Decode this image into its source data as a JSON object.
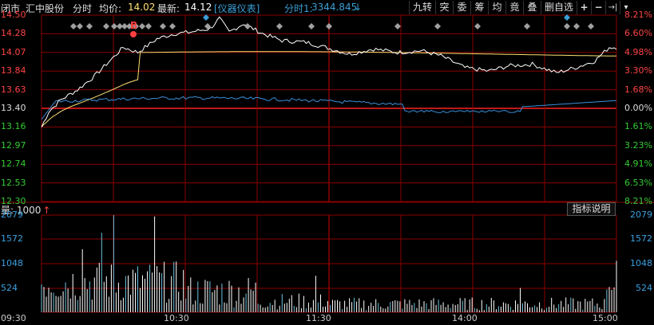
{
  "header": {
    "market": "闭市",
    "stock_name": "汇中股份",
    "chart_type": "分时",
    "avg_label": "均价:",
    "avg_value": "14.02",
    "last_label": "最新:",
    "last_value": "14.12",
    "indicator": "[仪器仪表]",
    "fenshi_label": "分时1:",
    "fenshi_value": "3344.845",
    "arrow": "↓"
  },
  "toolbar": [
    "九转",
    "突",
    "委",
    "筹",
    "均",
    "竟",
    "叠",
    "删自选",
    "+",
    "−",
    "→|",
    "▾"
  ],
  "price_axis": {
    "left": [
      "14.50",
      "14.28",
      "14.07",
      "13.84",
      "13.63",
      "13.40",
      "13.16",
      "12.97",
      "12.74",
      "12.53",
      "12.30"
    ],
    "right": [
      "8.21%",
      "6.60%",
      "4.98%",
      "3.30%",
      "1.68%",
      "0.00%",
      "1.61%",
      "3.23%",
      "4.91%",
      "6.53%",
      "8.21%"
    ]
  },
  "volume": {
    "label": "量: 1000",
    "arrow": "↑",
    "explain_button": "指标说明",
    "axis": [
      "2079",
      "1572",
      "1048",
      "524"
    ]
  },
  "time_axis": [
    "09:30",
    "10:30",
    "11:30",
    "14:00",
    "15:00"
  ],
  "marker_b": "B",
  "colors": {
    "up": "#ff4444",
    "down": "#33cc33",
    "flat": "#dddddd",
    "grid": "#8b0000",
    "price_line": "#ffffff",
    "avg_line": "#ffe070",
    "fenshi_line": "#3a8fd8",
    "volume_bar": "#ffffff",
    "volume_bar_blue": "#6fc3e0",
    "diamond": "#a0a0a0",
    "diamond_blue": "#3a9fd8"
  }
}
